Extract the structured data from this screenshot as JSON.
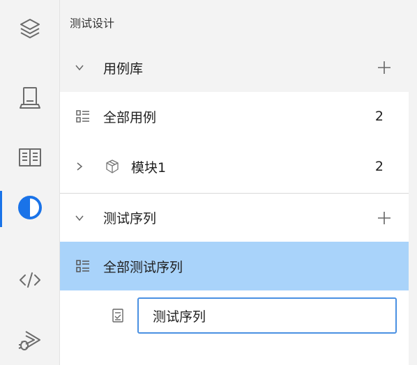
{
  "panel": {
    "title": "测试设计"
  },
  "case_library": {
    "label": "用例库",
    "expanded": true,
    "items": [
      {
        "label": "全部用例",
        "count": "2",
        "icon": "list-icon"
      },
      {
        "label": "模块1",
        "count": "2",
        "icon": "cube-icon",
        "collapsed": true
      }
    ]
  },
  "test_sequence": {
    "label": "测试序列",
    "expanded": true,
    "all_label": "全部测试序列",
    "new_item_value": "测试序列"
  },
  "activity_bar": [
    {
      "icon": "layers-icon"
    },
    {
      "icon": "device-icon"
    },
    {
      "icon": "book-icon"
    },
    {
      "icon": "contrast-icon",
      "active": true
    },
    {
      "icon": "code-icon"
    },
    {
      "icon": "bug-run-icon"
    }
  ],
  "colors": {
    "accent": "#1a73e8",
    "selection": "#a9d3fa",
    "input_border": "#4a90e2",
    "header_bg": "#f3f3f3"
  }
}
